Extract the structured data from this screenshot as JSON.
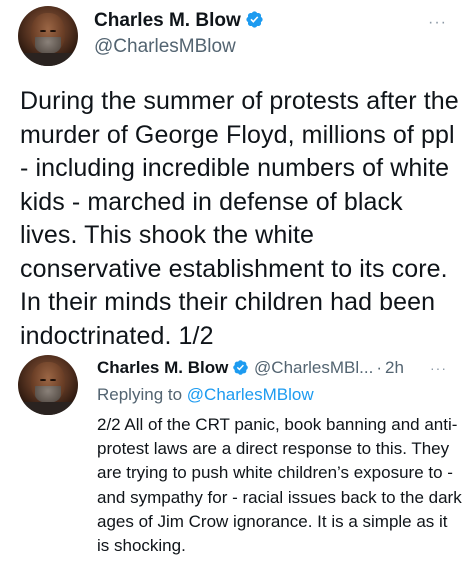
{
  "main_tweet": {
    "author_name": "Charles M. Blow",
    "author_handle": "@CharlesMBlow",
    "more_label": "···",
    "text": "During the summer of protests after the murder of George Floyd, millions of ppl - including incredible numbers of white kids - marched in defense of black lives. This shook the white conservative establishment to its core. In their minds their children had been indoctrinated. 1/2"
  },
  "reply_tweet": {
    "author_name": "Charles M. Blow",
    "author_handle": "@CharlesMBl...",
    "separator": "·",
    "time": "2h",
    "more_label": "···",
    "replying_to_label": "Replying to",
    "replying_to_handle": "@CharlesMBlow",
    "text": "2/2 All of the CRT panic, book banning and anti-protest laws are a direct response to this. They are trying to push white children’s exposure to - and sympathy for - racial issues back to the dark ages of Jim Crow ignorance. It is a simple as it is shocking."
  },
  "colors": {
    "verified": "#1d9bf0",
    "secondary_text": "#536471",
    "primary_text": "#0f1419",
    "link": "#1d9bf0"
  },
  "icons": {
    "verified": "verified-badge-icon",
    "more": "more-options-icon",
    "avatar": "profile-avatar"
  }
}
